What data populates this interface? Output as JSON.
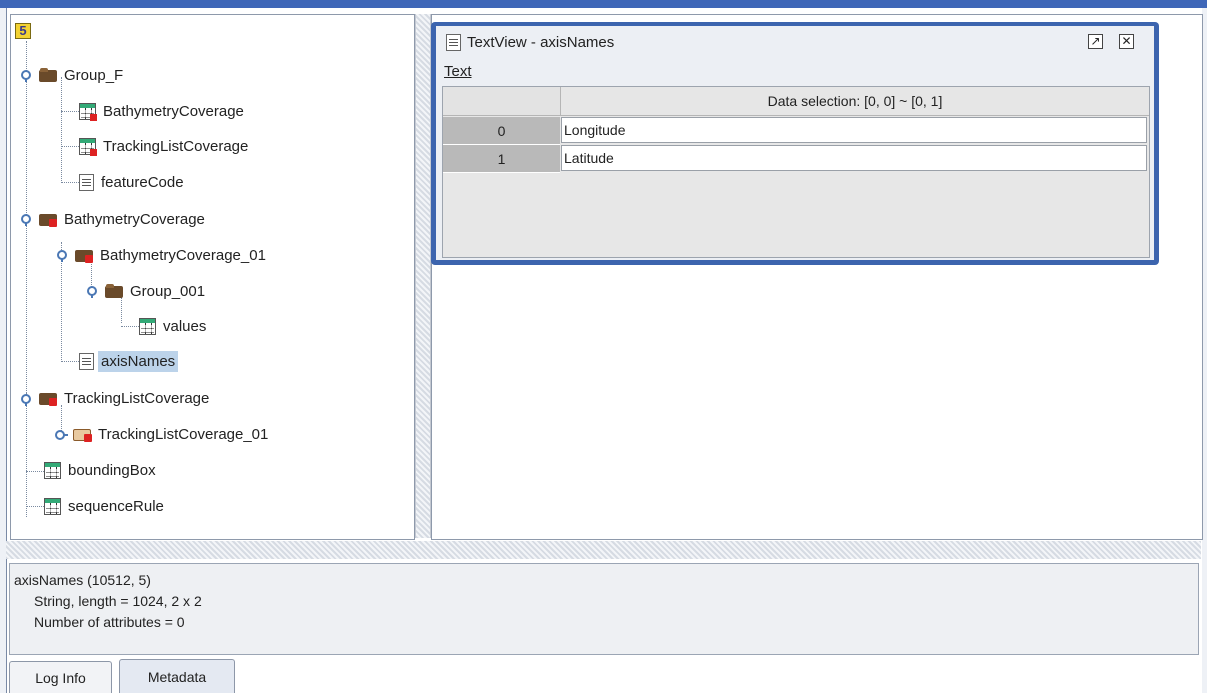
{
  "tree": {
    "root_icon_letter": "5",
    "items": [
      {
        "label": "Group_F",
        "icon": "folder-icon"
      },
      {
        "label": "BathymetryCoverage",
        "icon": "dataset-icon"
      },
      {
        "label": "TrackingListCoverage",
        "icon": "dataset-icon"
      },
      {
        "label": "featureCode",
        "icon": "text-icon"
      },
      {
        "label": "BathymetryCoverage",
        "icon": "folder-icon"
      },
      {
        "label": "BathymetryCoverage_01",
        "icon": "folder-icon"
      },
      {
        "label": "Group_001",
        "icon": "folder-icon"
      },
      {
        "label": "values",
        "icon": "dataset-icon"
      },
      {
        "label": "axisNames",
        "icon": "text-icon",
        "selected": true
      },
      {
        "label": "TrackingListCoverage",
        "icon": "folder-icon"
      },
      {
        "label": "TrackingListCoverage_01",
        "icon": "open-folder-icon"
      },
      {
        "label": "boundingBox",
        "icon": "dataset-icon"
      },
      {
        "label": "sequenceRule",
        "icon": "dataset-icon"
      }
    ]
  },
  "textview": {
    "title": "TextView  -  axisNames",
    "menu_text": "Text",
    "maximize_glyph": "↗",
    "close_glyph": "✕",
    "header": "Data selection:  [0, 0] ~ [0, 1]",
    "rows": [
      {
        "index": "0",
        "value": "Longitude"
      },
      {
        "index": "1",
        "value": "Latitude"
      }
    ]
  },
  "info": {
    "line1": "axisNames (10512, 5)",
    "line2": "String, length = 1024,    2 x 2",
    "line3": "Number of attributes = 0"
  },
  "tabs": {
    "log_info": "Log Info",
    "metadata": "Metadata"
  },
  "colors": {
    "accent": "#3c64ae",
    "selection": "#bcd3ea",
    "toggle": "#4a77b4"
  }
}
